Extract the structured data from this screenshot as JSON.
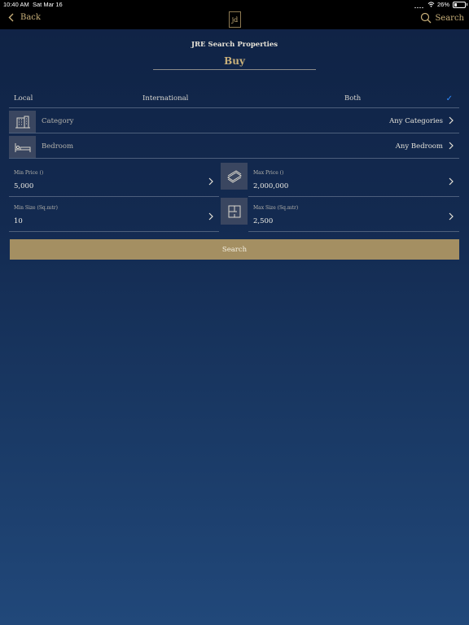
{
  "status": {
    "time": "10:40 AM",
    "date": "Sat Mar 16",
    "battery": "26%",
    "battery_level": 0.26
  },
  "nav": {
    "back_label": "Back",
    "logo_text": "jd",
    "search_label": "Search"
  },
  "header": {
    "title": "JRE Search Properties",
    "subtitle": "Buy"
  },
  "location": {
    "options": [
      "Local",
      "International",
      "Both"
    ],
    "selected": "Both"
  },
  "category": {
    "label": "Category",
    "value": "Any Categories"
  },
  "bedroom": {
    "label": "Bedroom",
    "value": "Any Bedroom"
  },
  "price": {
    "min_label": "Min Price ()",
    "min_value": "5,000",
    "max_label": "Max Price ()",
    "max_value": "2,000,000"
  },
  "size": {
    "min_label": "Min Size (Sq.mtr)",
    "min_value": "10",
    "max_label": "Max Size (Sq.mtr)",
    "max_value": "2,500"
  },
  "search_button": "Search",
  "colors": {
    "accent_gold": "#c9b07a",
    "button": "#a48f62",
    "check": "#2f8cff",
    "background": "#132a50"
  },
  "icons": [
    "chevron-left-icon",
    "search-icon",
    "building-icon",
    "bed-icon",
    "money-icon",
    "floorplan-icon",
    "chevron-right-icon",
    "checkmark-icon",
    "wifi-icon",
    "battery-icon"
  ]
}
